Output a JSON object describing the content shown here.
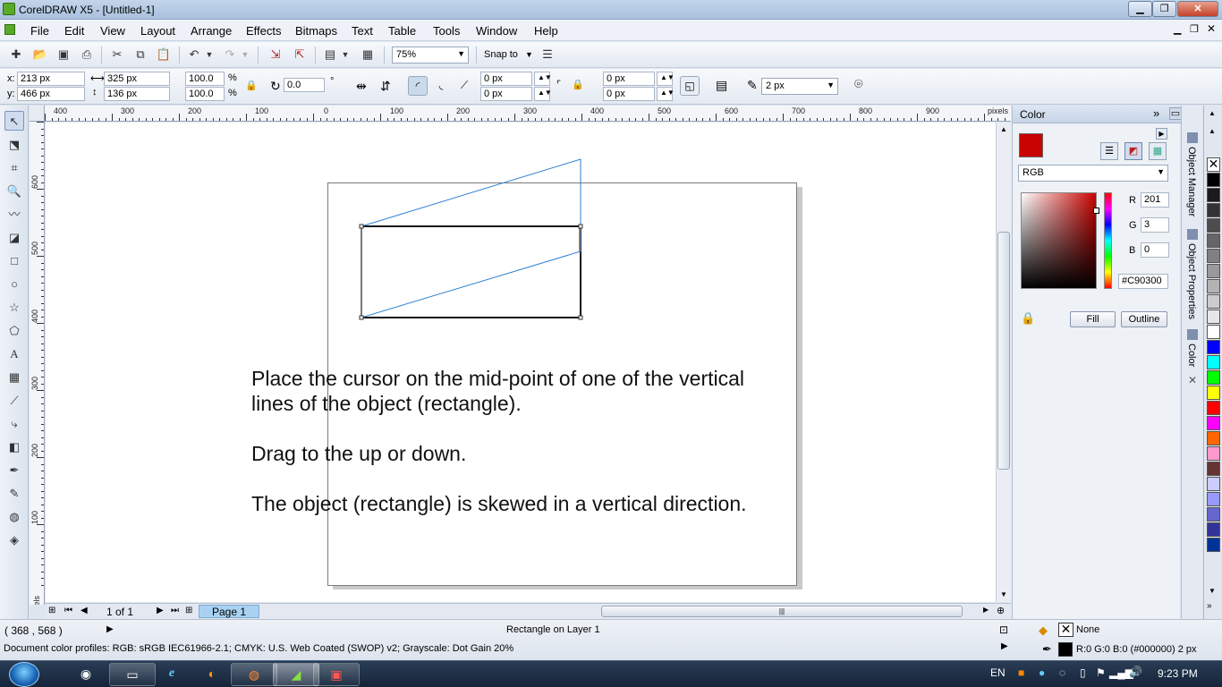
{
  "window": {
    "title": "CorelDRAW X5 - [Untitled-1]",
    "min_label": "▁",
    "max_label": "❐",
    "close_label": "✕"
  },
  "menu": [
    "File",
    "Edit",
    "View",
    "Layout",
    "Arrange",
    "Effects",
    "Bitmaps",
    "Text",
    "Table",
    "Tools",
    "Window",
    "Help"
  ],
  "toolbar": {
    "zoom_value": "75%",
    "snap_label": "Snap to"
  },
  "property_bar": {
    "x_label": "x:",
    "x_value": "213 px",
    "y_label": "y:",
    "y_value": "466 px",
    "width_value": "325 px",
    "height_value": "136 px",
    "scale_x": "100.0",
    "scale_y": "100.0",
    "percent": "%",
    "rotation": "0.0",
    "degree": "°",
    "corner_tl": "0 px",
    "corner_bl": "0 px",
    "corner_tr": "0 px",
    "corner_br": "0 px",
    "outline_width": "2 px"
  },
  "rulers": {
    "unit": "pixels",
    "h_labels": [
      "400",
      "300",
      "200",
      "100",
      "0",
      "100",
      "200",
      "300",
      "400",
      "500",
      "600",
      "700",
      "800",
      "900"
    ],
    "v_labels": [
      "600",
      "500",
      "400",
      "300",
      "200",
      "100"
    ]
  },
  "instructions": {
    "line1": "Place the cursor on the mid-point of one of the vertical",
    "line2": "lines of the object (rectangle).",
    "line3": "Drag to the up or down.",
    "line4": "The object (rectangle) is skewed in a vertical direction."
  },
  "page_nav": {
    "page_count": "1 of 1",
    "page_tab": "Page 1"
  },
  "color_docker": {
    "title": "Color",
    "model": "RGB",
    "r_label": "R",
    "r_value": "201",
    "g_label": "G",
    "g_value": "3",
    "b_label": "B",
    "b_value": "0",
    "hex_value": "#C90300",
    "fill_label": "Fill",
    "outline_label": "Outline",
    "current_color": "#C90300"
  },
  "docker_tabs": [
    "Object Manager",
    "Object Properties",
    "Color"
  ],
  "palette_colors": [
    "#000000",
    "#1a1a1a",
    "#333333",
    "#4d4d4d",
    "#666666",
    "#808080",
    "#999999",
    "#b3b3b3",
    "#cccccc",
    "#e6e6e6",
    "#ffffff",
    "#0000ff",
    "#00ffff",
    "#00ff00",
    "#ffff00",
    "#ff0000",
    "#ff00ff",
    "#ff6600",
    "#ff99cc",
    "#663333",
    "#ccccff",
    "#9999ff",
    "#6666cc",
    "#333399",
    "#003399"
  ],
  "status": {
    "coords": "( 368  , 568  )",
    "selection": "Rectangle on Layer 1",
    "color_profiles": "Document color profiles: RGB: sRGB IEC61966-2.1; CMYK: U.S. Web Coated (SWOP) v2; Grayscale: Dot Gain 20%",
    "fill_text": "None",
    "outline_text": "R:0 G:0 B:0 (#000000)  2 px"
  },
  "taskbar": {
    "language": "EN",
    "time": "9:23 PM"
  }
}
